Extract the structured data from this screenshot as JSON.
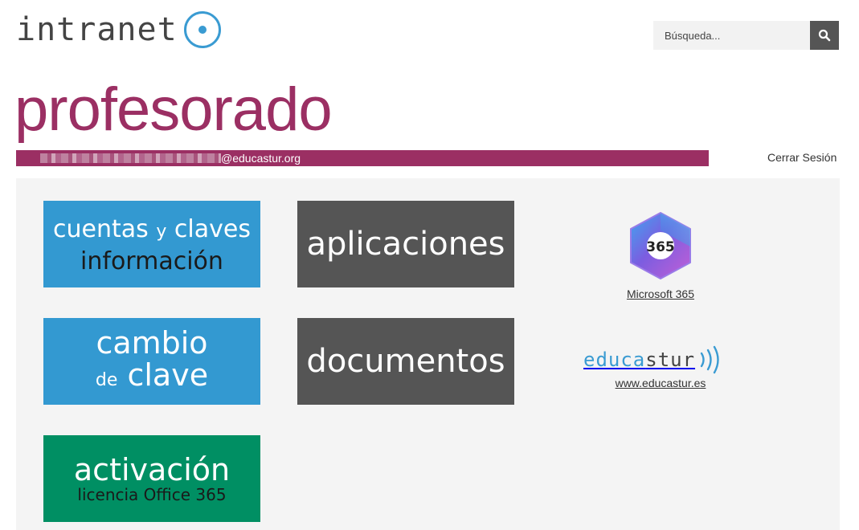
{
  "header": {
    "logo_text": "intranet",
    "search": {
      "placeholder": "Búsqueda..."
    }
  },
  "page_title": "profesorado",
  "user": {
    "email_domain": "@educastur.org",
    "logout_label": "Cerrar Sesión"
  },
  "tiles": {
    "cuentas": {
      "line1a": "cuentas",
      "line1b": "y",
      "line1c": "claves",
      "line2": "información"
    },
    "aplicaciones": {
      "label": "aplicaciones"
    },
    "cambio": {
      "line1": "cambio",
      "line2a": "de",
      "line2b": "clave"
    },
    "documentos": {
      "label": "documentos"
    },
    "activacion": {
      "line1": "activación",
      "line2": "licencia Office 365"
    }
  },
  "links": {
    "microsoft": {
      "badge": "365",
      "label": "Microsoft 365"
    },
    "educastur": {
      "logo_a": "educa",
      "logo_b": "stur",
      "label": "www.educastur.es"
    }
  },
  "colors": {
    "brand": "#9b2f63",
    "blue": "#3399d1",
    "gray": "#555555",
    "green": "#008f63",
    "accent": "#3a9bd2"
  }
}
